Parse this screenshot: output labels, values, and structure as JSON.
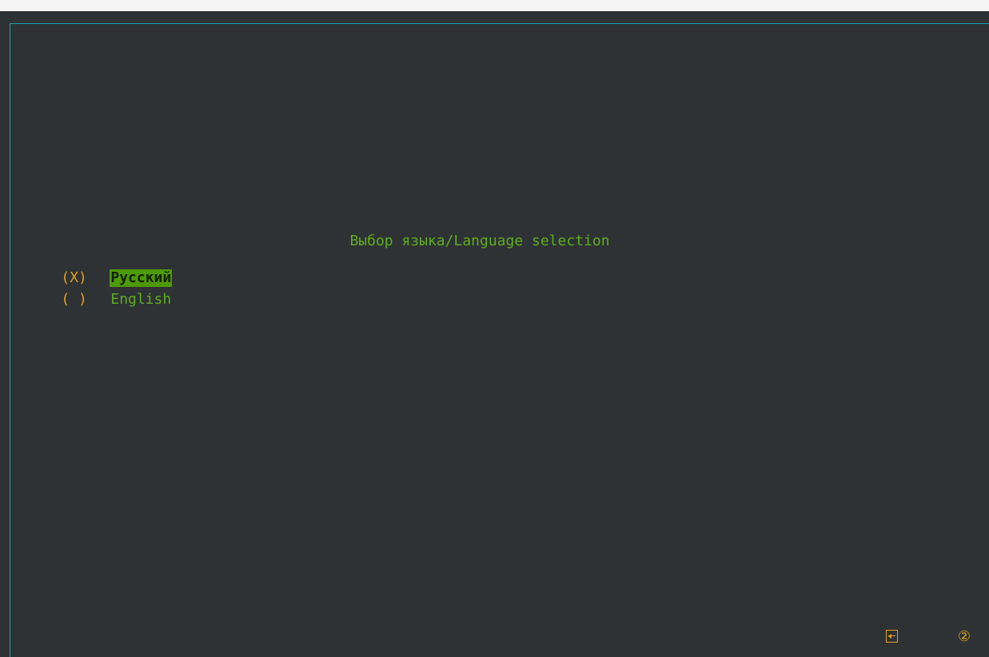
{
  "dialog": {
    "title": "Выбор языка/Language selection"
  },
  "options": [
    {
      "radio": "(X)",
      "label": "Русский",
      "selected": true
    },
    {
      "radio": "( )",
      "label": "English",
      "selected": false
    }
  ],
  "footer": {
    "exit_icon": "exit-icon",
    "help_icon": "help-icon",
    "help_glyph": "②"
  },
  "colors": {
    "background": "#2e3235",
    "frame": "#1aa3a8",
    "text_green": "#5fad1f",
    "accent_yellow": "#e0a019",
    "highlight": "#4e9a06"
  }
}
